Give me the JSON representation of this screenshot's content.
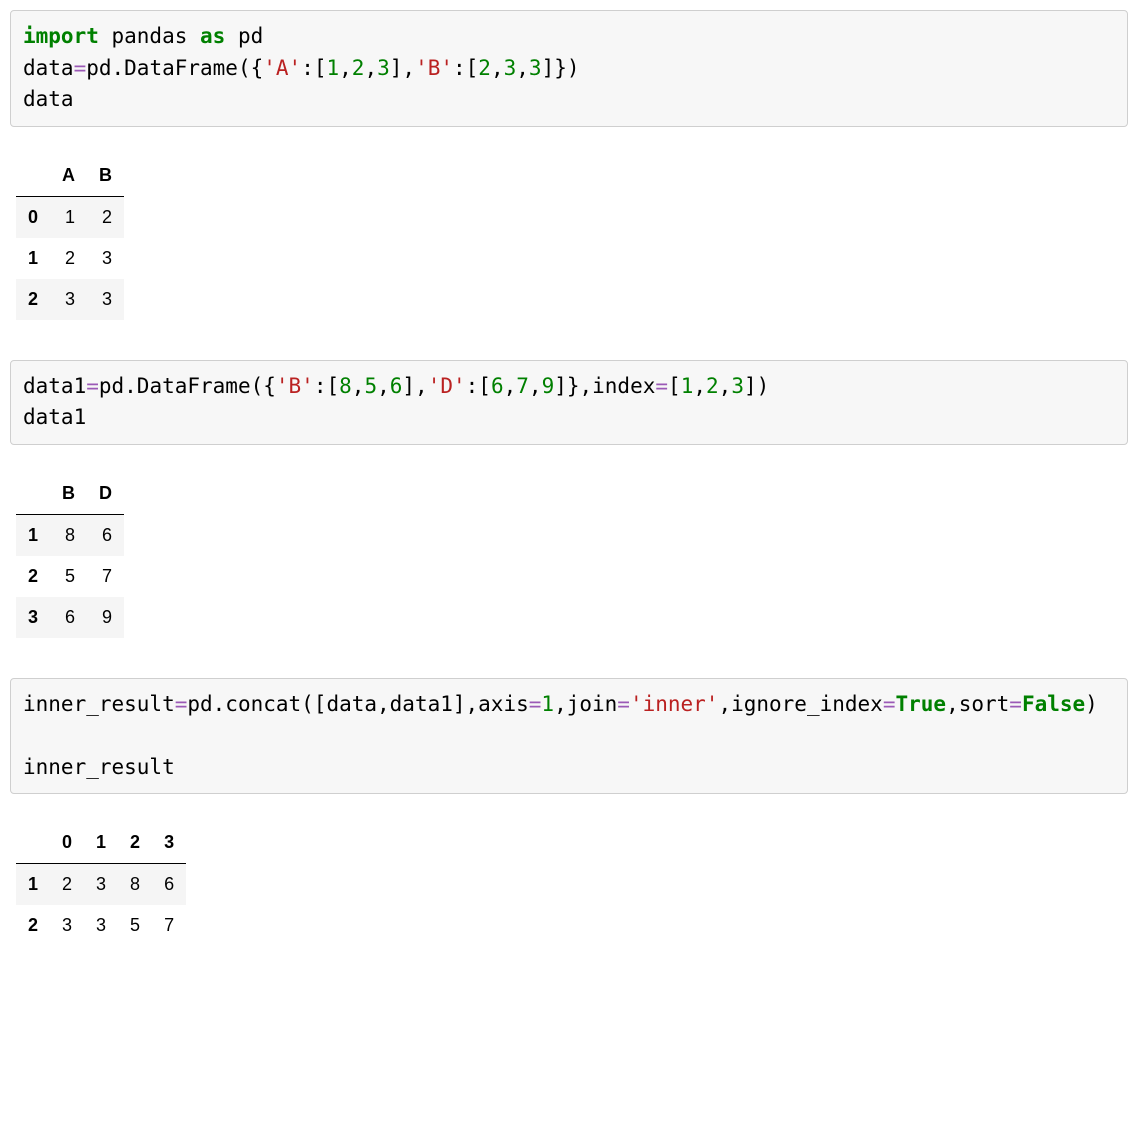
{
  "cells": [
    {
      "code_html": "<span class='kw-green'>import</span> pandas <span class='kw-green'>as</span> pd\ndata<span class='purple'>=</span>pd.DataFrame({<span class='str'>'A'</span>:[<span class='num'>1</span>,<span class='num'>2</span>,<span class='num'>3</span>],<span class='str'>'B'</span>:[<span class='num'>2</span>,<span class='num'>3</span>,<span class='num'>3</span>]})\ndata",
      "table": {
        "columns": [
          "A",
          "B"
        ],
        "index": [
          "0",
          "1",
          "2"
        ],
        "rows": [
          [
            "1",
            "2"
          ],
          [
            "2",
            "3"
          ],
          [
            "3",
            "3"
          ]
        ]
      }
    },
    {
      "code_html": "data1<span class='purple'>=</span>pd.DataFrame({<span class='str'>'B'</span>:[<span class='num'>8</span>,<span class='num'>5</span>,<span class='num'>6</span>],<span class='str'>'D'</span>:[<span class='num'>6</span>,<span class='num'>7</span>,<span class='num'>9</span>]},index<span class='purple'>=</span>[<span class='num'>1</span>,<span class='num'>2</span>,<span class='num'>3</span>])\ndata1",
      "table": {
        "columns": [
          "B",
          "D"
        ],
        "index": [
          "1",
          "2",
          "3"
        ],
        "rows": [
          [
            "8",
            "6"
          ],
          [
            "5",
            "7"
          ],
          [
            "6",
            "9"
          ]
        ]
      }
    },
    {
      "code_html": "inner_result<span class='purple'>=</span>pd.concat([data,data1],axis<span class='purple'>=</span><span class='num'>1</span>,join<span class='purple'>=</span><span class='str'>'inner'</span>,ignore_index<span class='purple'>=</span><span class='bool'>True</span>,sort<span class='purple'>=</span><span class='bool'>False</span>)\n\ninner_result",
      "table": {
        "columns": [
          "0",
          "1",
          "2",
          "3"
        ],
        "index": [
          "1",
          "2"
        ],
        "rows": [
          [
            "2",
            "3",
            "8",
            "6"
          ],
          [
            "3",
            "3",
            "5",
            "7"
          ]
        ]
      }
    }
  ]
}
